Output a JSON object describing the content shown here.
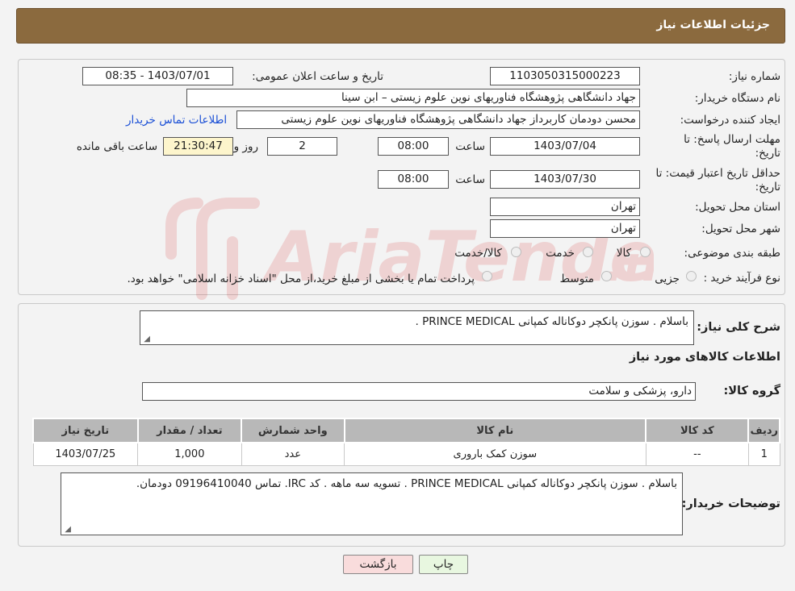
{
  "header": {
    "title": "جزئیات اطلاعات نیاز"
  },
  "form": {
    "need_number_label": "شماره نیاز:",
    "need_number": "1103050315000223",
    "announce_label": "تاریخ و ساعت اعلان عمومی:",
    "announce_value": "1403/07/01 - 08:35",
    "buyer_org_label": "نام دستگاه خریدار:",
    "buyer_org": "جهاد دانشگاهی پژوهشگاه فناوریهای نوین علوم زیستی – ابن سینا",
    "creator_label": "ایجاد کننده درخواست:",
    "creator": "محسن دودمان کاربرداز جهاد دانشگاهی پژوهشگاه فناوریهای نوین علوم زیستی",
    "contact_link": "اطلاعات تماس خریدار",
    "deadline_label_1": "مهلت ارسال پاسخ: تا",
    "deadline_label_2": "تاریخ:",
    "deadline_date": "1403/07/04",
    "time_label": "ساعت",
    "deadline_time": "08:00",
    "days_value": "2",
    "days_label": "روز و",
    "remaining_time": "21:30:47",
    "remaining_label": "ساعت باقی مانده",
    "validity_label_1": "حداقل تاریخ اعتبار قیمت: تا",
    "validity_label_2": "تاریخ:",
    "validity_date": "1403/07/30",
    "validity_time": "08:00",
    "province_label": "استان محل تحویل:",
    "province": "تهران",
    "city_label": "شهر محل تحویل:",
    "city": "تهران",
    "category_label": "طبقه بندی موضوعی:",
    "category_options": [
      "کالا",
      "خدمت",
      "کالا/خدمت"
    ],
    "process_label": "نوع فرآیند خرید :",
    "process_options": [
      "جزیی",
      "متوسط"
    ],
    "process_note": "پرداخت تمام یا بخشی از مبلغ خرید،از محل \"اسناد خزانه اسلامی\" خواهد بود."
  },
  "details": {
    "summary_label": "شرح کلی نیاز:",
    "summary": "باسلام . سوزن پانکچر دوکاناله کمپانی PRINCE MEDICAL .",
    "goods_info_title": "اطلاعات کالاهای مورد نیاز",
    "goods_group_label": "گروه کالا:",
    "goods_group": "دارو، پزشکی و سلامت",
    "table": {
      "headers": [
        "ردیف",
        "کد کالا",
        "نام کالا",
        "واحد شمارش",
        "تعداد / مقدار",
        "تاریخ نیاز"
      ],
      "rows": [
        [
          "1",
          "--",
          "سوزن کمک باروری",
          "عدد",
          "1,000",
          "1403/07/25"
        ]
      ]
    },
    "buyer_notes_label": "توضیحات خریدار:",
    "buyer_notes": "باسلام . سوزن پانکچر دوکاناله کمپانی PRINCE MEDICAL . تسویه سه ماهه . کد IRC. تماس 09196410040 دودمان."
  },
  "buttons": {
    "print": "چاپ",
    "back": "بازگشت"
  },
  "colors": {
    "header_bg": "#8b6a3e",
    "link": "#1a4fd6",
    "back_btn_bg": "#f9dcdc",
    "print_btn_bg": "#e8f7e0"
  }
}
